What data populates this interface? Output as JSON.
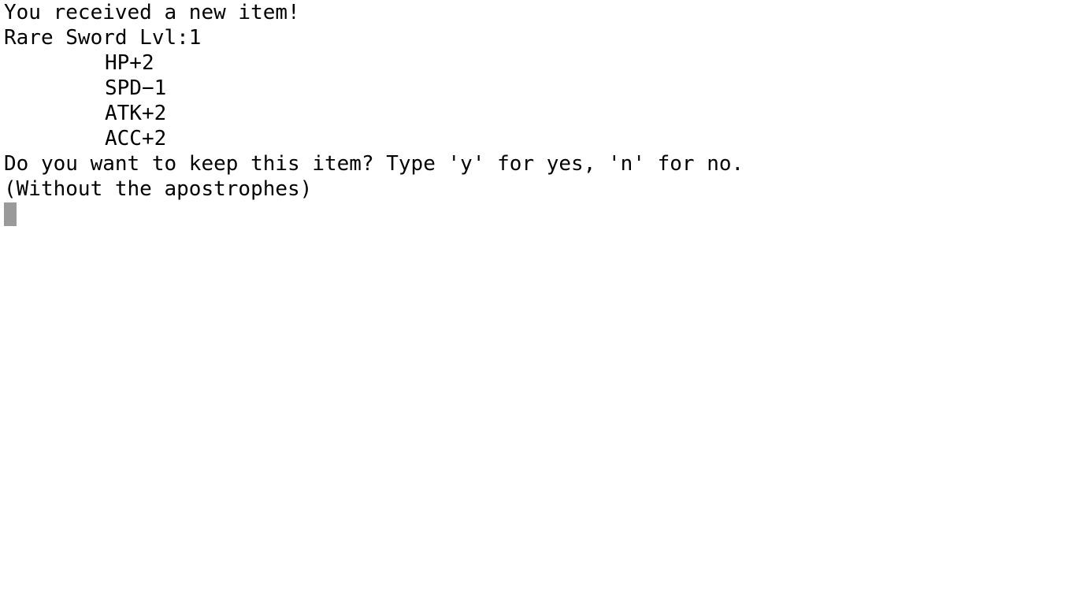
{
  "terminal": {
    "lines": {
      "received": "You received a new item!",
      "item_name": "Rare Sword Lvl:1"
    },
    "stats": [
      "HP+2",
      "SPD−1",
      "ATK+2",
      "ACC+2"
    ],
    "prompt": "Do you want to keep this item? Type 'y' for yes, 'n' for no.",
    "prompt_note": "(Without the apostrophes)",
    "input_value": ""
  },
  "colors": {
    "background": "#ffffff",
    "text": "#000000",
    "cursor": "#9a9a9a"
  }
}
